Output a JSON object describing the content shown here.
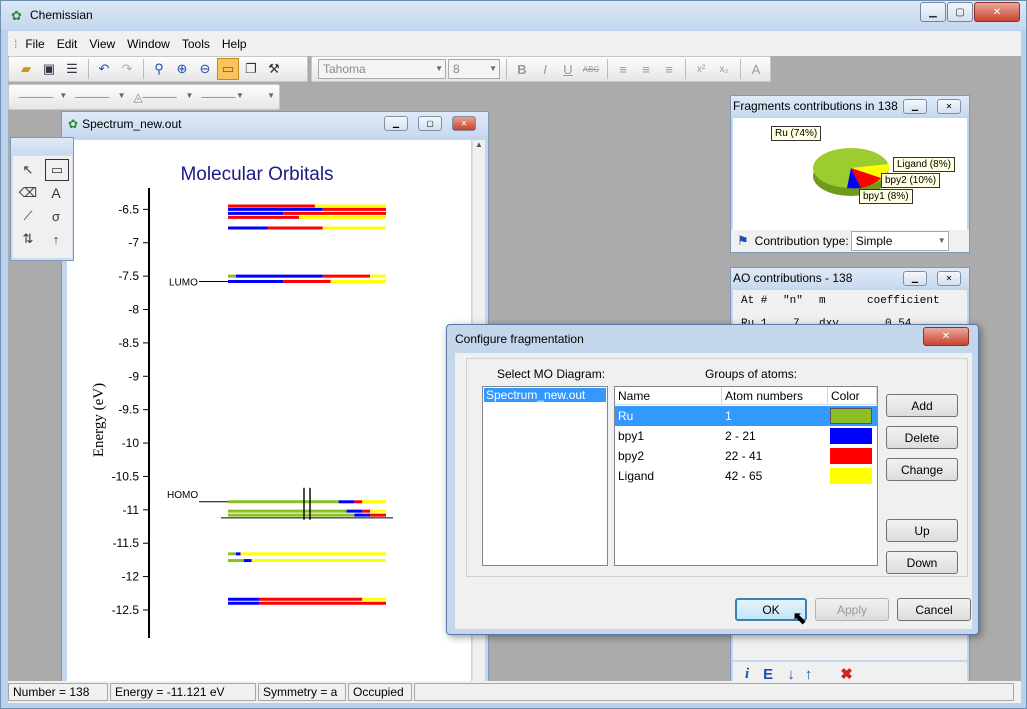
{
  "app": {
    "title": "Chemissian"
  },
  "menu": [
    "File",
    "Edit",
    "View",
    "Window",
    "Tools",
    "Help"
  ],
  "format": {
    "font": "Tahoma",
    "size": "8"
  },
  "spectrum": {
    "title": "Spectrum_new.out",
    "heading": "Molecular Orbitals",
    "ylabel": "Energy (eV)",
    "lumo": "LUMO",
    "homo": "HOMO"
  },
  "chart_data": {
    "type": "diagram",
    "title": "Molecular Orbitals",
    "ylabel": "Energy (eV)",
    "ylim": [
      -12.8,
      -6.3
    ],
    "yticks": [
      -6.5,
      -7,
      -7.5,
      -8,
      -8.5,
      -9,
      -9.5,
      -10,
      -10.5,
      -11,
      -11.5,
      -12,
      -12.5
    ],
    "levels": [
      {
        "e": -6.45,
        "segs": [
          [
            "#ff0000",
            0.55
          ],
          [
            "#ffff00",
            0.45
          ]
        ]
      },
      {
        "e": -6.5,
        "segs": [
          [
            "#0000ff",
            0.6
          ],
          [
            "#ff0000",
            0.4
          ]
        ]
      },
      {
        "e": -6.56,
        "segs": [
          [
            "#0000ff",
            0.35
          ],
          [
            "#ff0000",
            0.65
          ]
        ]
      },
      {
        "e": -6.62,
        "segs": [
          [
            "#ff0000",
            0.45
          ],
          [
            "#ffff00",
            0.55
          ]
        ]
      },
      {
        "e": -6.78,
        "segs": [
          [
            "#0000ff",
            0.25
          ],
          [
            "#ff0000",
            0.35
          ],
          [
            "#ffff00",
            0.4
          ]
        ]
      },
      {
        "e": -7.5,
        "segs": [
          [
            "#8cbf26",
            0.05
          ],
          [
            "#0000ff",
            0.55
          ],
          [
            "#ff0000",
            0.3
          ],
          [
            "#ffff00",
            0.1
          ]
        ]
      },
      {
        "e": -7.58,
        "segs": [
          [
            "#0000ff",
            0.35
          ],
          [
            "#ff0000",
            0.3
          ],
          [
            "#ffff00",
            0.35
          ]
        ]
      },
      {
        "e": -10.88,
        "segs": [
          [
            "#8cbf26",
            0.7
          ],
          [
            "#0000ff",
            0.1
          ],
          [
            "#ff0000",
            0.05
          ],
          [
            "#ffff00",
            0.15
          ]
        ]
      },
      {
        "e": -11.02,
        "segs": [
          [
            "#8cbf26",
            0.75
          ],
          [
            "#0000ff",
            0.1
          ],
          [
            "#ff0000",
            0.05
          ],
          [
            "#ffff00",
            0.1
          ]
        ]
      },
      {
        "e": -11.08,
        "segs": [
          [
            "#8cbf26",
            0.8
          ],
          [
            "#0000ff",
            0.1
          ],
          [
            "#ff0000",
            0.1
          ]
        ]
      },
      {
        "e": -11.66,
        "segs": [
          [
            "#8cbf26",
            0.05
          ],
          [
            "#0000ff",
            0.03
          ],
          [
            "#ffff00",
            0.92
          ]
        ]
      },
      {
        "e": -11.76,
        "segs": [
          [
            "#8cbf26",
            0.1
          ],
          [
            "#0000ff",
            0.05
          ],
          [
            "#ffff00",
            0.85
          ]
        ]
      },
      {
        "e": -12.34,
        "segs": [
          [
            "#0000ff",
            0.2
          ],
          [
            "#ff0000",
            0.65
          ],
          [
            "#ffff00",
            0.15
          ]
        ]
      },
      {
        "e": -12.4,
        "segs": [
          [
            "#0000ff",
            0.2
          ],
          [
            "#ff0000",
            0.8
          ]
        ]
      }
    ]
  },
  "fragments": {
    "title": "Fragments contributions in 138",
    "ru": "Ru (74%)",
    "ligand": "Ligand (8%)",
    "bpy2": "bpy2 (10%)",
    "bpy1": "bpy1 (8%)",
    "type_label": "Contribution type:",
    "type_value": "Simple"
  },
  "ao": {
    "title": "AO contributions - 138",
    "cols": [
      "At #",
      "\"n\"",
      "m",
      "coefficient"
    ],
    "row": [
      "Ru 1",
      "7",
      "dxy",
      "0.54"
    ]
  },
  "dialog": {
    "title": "Configure fragmentation",
    "select_label": "Select MO Diagram:",
    "groups_label": "Groups of atoms:",
    "mo_item": "Spectrum_new.out",
    "headers": [
      "Name",
      "Atom numbers",
      "Color"
    ],
    "rows": [
      {
        "name": "Ru",
        "atoms": "1",
        "color": "#8cbf26"
      },
      {
        "name": "bpy1",
        "atoms": "2 - 21",
        "color": "#0000ff"
      },
      {
        "name": "bpy2",
        "atoms": "22 - 41",
        "color": "#ff0000"
      },
      {
        "name": "Ligand",
        "atoms": "42 - 65",
        "color": "#ffff00"
      }
    ],
    "add": "Add",
    "delete": "Delete",
    "change": "Change",
    "up": "Up",
    "down": "Down",
    "ok": "OK",
    "apply": "Apply",
    "cancel": "Cancel"
  },
  "status": {
    "number": "Number = 138",
    "energy": "Energy = -11.121 eV",
    "symmetry": "Symmetry = a",
    "occupied": "Occupied"
  }
}
